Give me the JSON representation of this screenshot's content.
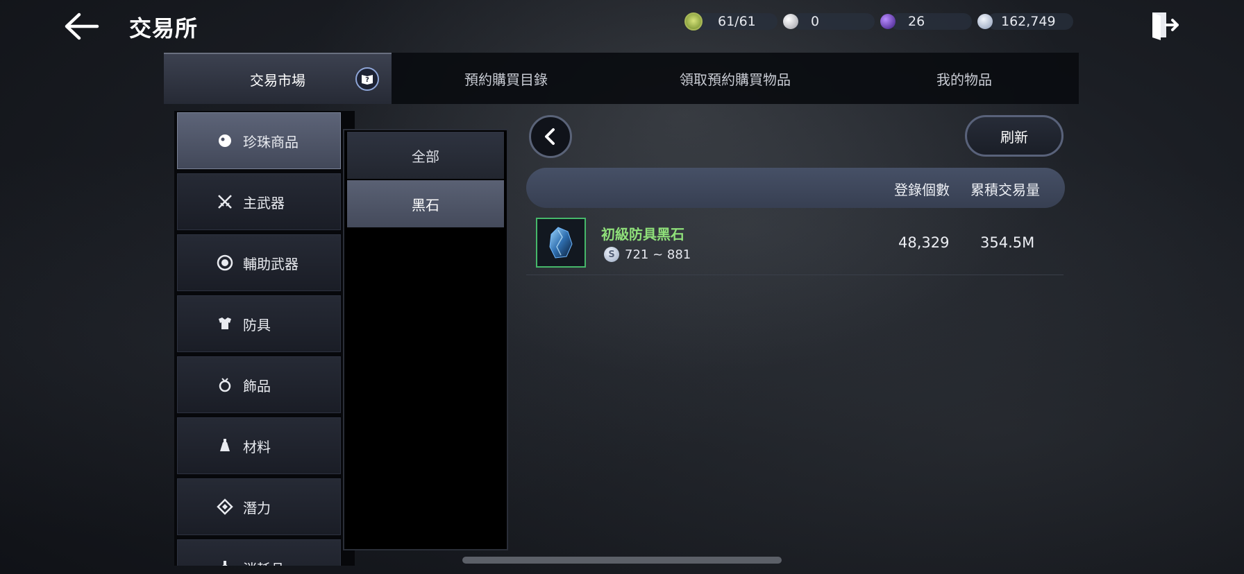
{
  "header": {
    "title": "交易所",
    "resources": [
      {
        "name": "energy",
        "value": "61/61",
        "color": "#c9d96a"
      },
      {
        "name": "pearl",
        "value": "0",
        "color": "#d8d8d8"
      },
      {
        "name": "black-pearl",
        "value": "26",
        "color": "#6b3fd0"
      },
      {
        "name": "silver",
        "value": "162,749",
        "color": "#b7c6e0"
      }
    ]
  },
  "tabs": [
    {
      "label": "交易市場",
      "active": true
    },
    {
      "label": "預約購買目錄",
      "active": false
    },
    {
      "label": "領取預約購買物品",
      "active": false
    },
    {
      "label": "我的物品",
      "active": false
    }
  ],
  "categories": [
    {
      "label": "珍珠商品",
      "icon": "pearl-icon",
      "active": true
    },
    {
      "label": "主武器",
      "icon": "crossed-swords-icon",
      "active": false
    },
    {
      "label": "輔助武器",
      "icon": "orb-icon",
      "active": false
    },
    {
      "label": "防具",
      "icon": "armor-icon",
      "active": false
    },
    {
      "label": "飾品",
      "icon": "ring-icon",
      "active": false
    },
    {
      "label": "材料",
      "icon": "potion-icon",
      "active": false
    },
    {
      "label": "潛力",
      "icon": "diamond-icon",
      "active": false
    },
    {
      "label": "消耗品",
      "icon": "flask-icon",
      "active": false
    }
  ],
  "subcategories": [
    {
      "label": "全部",
      "active": false
    },
    {
      "label": "黑石",
      "active": true
    }
  ],
  "toolbar": {
    "refresh_label": "刷新"
  },
  "table": {
    "headers": [
      "登錄個數",
      "累積交易量"
    ],
    "rows": [
      {
        "name": "初級防具黑石",
        "price": "721 ~ 881",
        "count": "48,329",
        "volume": "354.5M"
      }
    ]
  }
}
